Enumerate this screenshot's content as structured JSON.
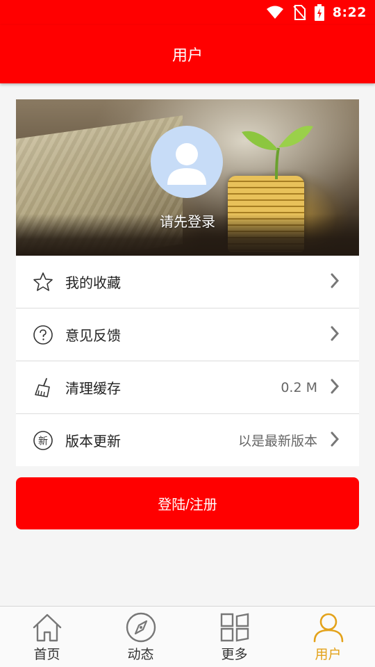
{
  "status_bar": {
    "time": "8:22",
    "icons": [
      "wifi-icon",
      "no-sim-icon",
      "battery-charging-icon"
    ]
  },
  "app_bar": {
    "title": "用户"
  },
  "profile": {
    "avatar_icon": "user-avatar-icon",
    "login_prompt": "请先登录"
  },
  "menu": {
    "items": [
      {
        "label": "我的收藏",
        "icon": "star-icon",
        "value": ""
      },
      {
        "label": "意见反馈",
        "icon": "question-circle-icon",
        "value": ""
      },
      {
        "label": "清理缓存",
        "icon": "broom-icon",
        "value": "0.2 M"
      },
      {
        "label": "版本更新",
        "icon": "new-badge-icon",
        "icon_text": "新",
        "value": "以是最新版本"
      }
    ]
  },
  "login_button": {
    "label": "登陆/注册"
  },
  "bottom_nav": {
    "items": [
      {
        "label": "首页",
        "icon": "home-icon",
        "active": false
      },
      {
        "label": "动态",
        "icon": "compass-icon",
        "active": false
      },
      {
        "label": "更多",
        "icon": "grid-icon",
        "active": false
      },
      {
        "label": "用户",
        "icon": "user-icon",
        "active": true
      }
    ]
  },
  "colors": {
    "primary": "#ff0000",
    "active_tab": "#e3a21a",
    "avatar_bg": "#c7dcf7",
    "background": "#f5f5f5"
  }
}
